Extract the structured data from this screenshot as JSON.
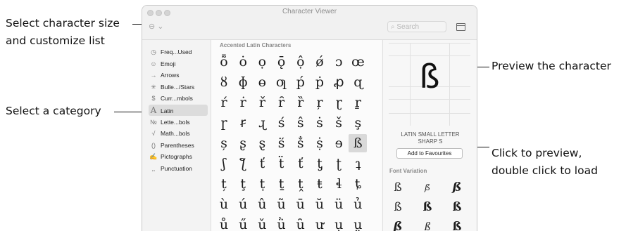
{
  "annotations": {
    "size_line1": "Select character size",
    "size_line2": "and customize list",
    "category": "Select a category",
    "preview": "Preview the character",
    "click_line1": "Click to preview,",
    "click_line2": "double click to load"
  },
  "window": {
    "title": "Character Viewer",
    "search_placeholder": "Search",
    "size_control": "⊖ ⌄"
  },
  "sidebar": {
    "items": [
      {
        "icon": "clock-icon",
        "glyph": "◷",
        "label": "Freq...Used",
        "selected": false
      },
      {
        "icon": "emoji-icon",
        "glyph": "☺",
        "label": "Emoji",
        "selected": false
      },
      {
        "icon": "arrow-icon",
        "glyph": "→",
        "label": "Arrows",
        "selected": false
      },
      {
        "icon": "star-icon",
        "glyph": "✳",
        "label": "Bulle.../Stars",
        "selected": false
      },
      {
        "icon": "currency-icon",
        "glyph": "$",
        "label": "Curr...mbols",
        "selected": false
      },
      {
        "icon": "latin-icon",
        "glyph": "A",
        "label": "Latin",
        "selected": true
      },
      {
        "icon": "letterlike-icon",
        "glyph": "№",
        "label": "Lette...bols",
        "selected": false
      },
      {
        "icon": "math-icon",
        "glyph": "√",
        "label": "Math...bols",
        "selected": false
      },
      {
        "icon": "parentheses-icon",
        "glyph": "()",
        "label": "Parentheses",
        "selected": false
      },
      {
        "icon": "pictograph-icon",
        "glyph": "✍",
        "label": "Pictographs",
        "selected": false
      },
      {
        "icon": "punctuation-icon",
        "glyph": "‚,",
        "label": "Punctuation",
        "selected": false
      }
    ]
  },
  "content": {
    "section_header": "Accented Latin Characters",
    "grid": [
      [
        "ȭ",
        "ȯ",
        "ọ",
        "ǭ",
        "ộ",
        "ǿ",
        "ɔ",
        "œ"
      ],
      [
        "ȣ",
        "ɸ",
        "ɵ",
        "ƣ",
        "ṕ",
        "ṗ",
        "ꝓ",
        "ɋ"
      ],
      [
        "ŕ",
        "ṙ",
        "ř",
        "ȓ",
        "ȑ",
        "ŗ",
        "ɽ",
        "ṟ"
      ],
      [
        "ɼ",
        "ꞧ",
        "ɻ",
        "ś",
        "ŝ",
        "ṡ",
        "š",
        "ş"
      ],
      [
        "ș",
        "ʂ",
        "ȿ",
        "ṥ",
        "ṧ",
        "ṩ",
        "ɘ",
        "ß"
      ],
      [
        "ʃ",
        "ƪ",
        "ť",
        "ẗ",
        "ť",
        "ƫ",
        "ʈ",
        "ʇ"
      ],
      [
        "ț",
        "ţ",
        "ṭ",
        "ṯ",
        "ṱ",
        "ŧ",
        "ɬ",
        "ȶ"
      ],
      [
        "ù",
        "ú",
        "û",
        "ũ",
        "ū",
        "ŭ",
        "ü",
        "ủ"
      ],
      [
        "ů",
        "ű",
        "ǔ",
        "ǜ",
        "ȗ",
        "ư",
        "ụ",
        "ṳ"
      ]
    ],
    "selected": {
      "row": 4,
      "col": 7
    }
  },
  "preview": {
    "glyph": "ß",
    "name_line1": "LATIN SMALL LETTER",
    "name_line2": "SHARP S",
    "favourites_button": "Add to Favourites",
    "font_variation_header": "Font Variation",
    "variations": [
      "ß",
      "ß",
      "ß",
      "ß",
      "ß",
      "ß",
      "ß",
      "ß",
      "ß"
    ]
  }
}
